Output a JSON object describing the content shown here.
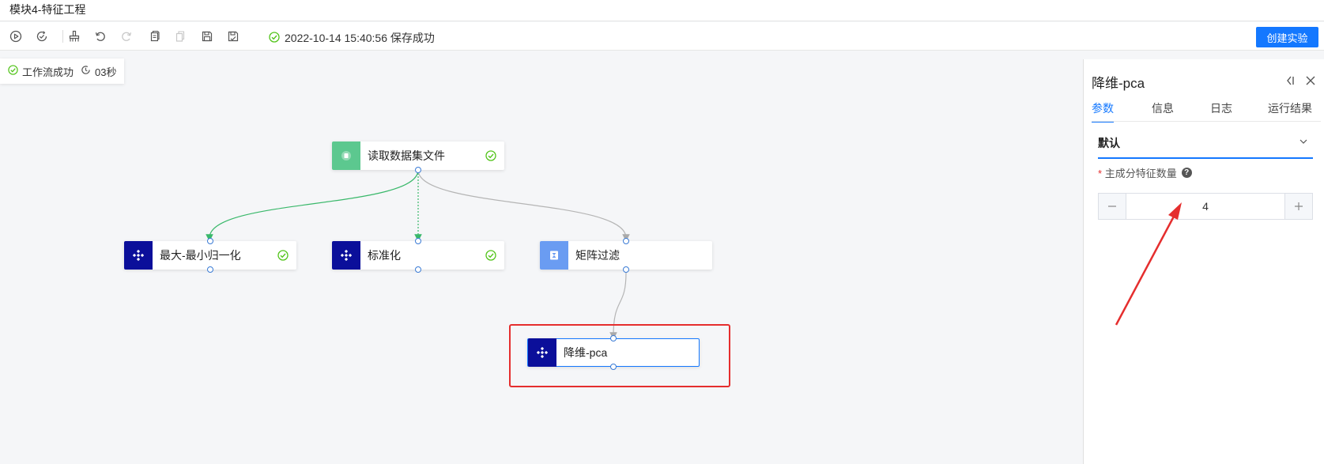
{
  "window": {
    "title": "模块4-特征工程"
  },
  "toolbar": {
    "save_status": "2022-10-14 15:40:56 保存成功",
    "create_label": "创建实验",
    "icons": [
      "run-icon",
      "sync-icon",
      "clean-icon",
      "undo-icon",
      "redo-icon",
      "copy-icon",
      "paste-icon",
      "save-icon",
      "save-as-icon"
    ]
  },
  "workflow": {
    "status": "工作流成功",
    "duration": "03秒"
  },
  "nodes": [
    {
      "label": "读取数据集文件",
      "icon": "dataset-icon",
      "color": "#5cc88f",
      "done": true
    },
    {
      "label": "最大-最小归一化",
      "icon": "component-icon",
      "color": "#0b0f9a",
      "done": true
    },
    {
      "label": "标准化",
      "icon": "component-icon",
      "color": "#0b0f9a",
      "done": true
    },
    {
      "label": "矩阵过滤",
      "icon": "filter-icon",
      "color": "#6a9cf2",
      "done": false
    },
    {
      "label": "降维-pca",
      "icon": "component-icon",
      "color": "#0b0f9a",
      "done": false,
      "selected": true
    }
  ],
  "panel": {
    "title": "降维-pca",
    "tabs": [
      "参数",
      "信息",
      "日志",
      "运行结果"
    ],
    "active_tab": "参数",
    "section": "默认",
    "param_label": "主成分特征数量",
    "param_value": "4",
    "required_mark": "*",
    "help_glyph": "?"
  },
  "colors": {
    "accent": "#1478ff",
    "success": "#52c41a",
    "highlight": "#e52e2e"
  }
}
